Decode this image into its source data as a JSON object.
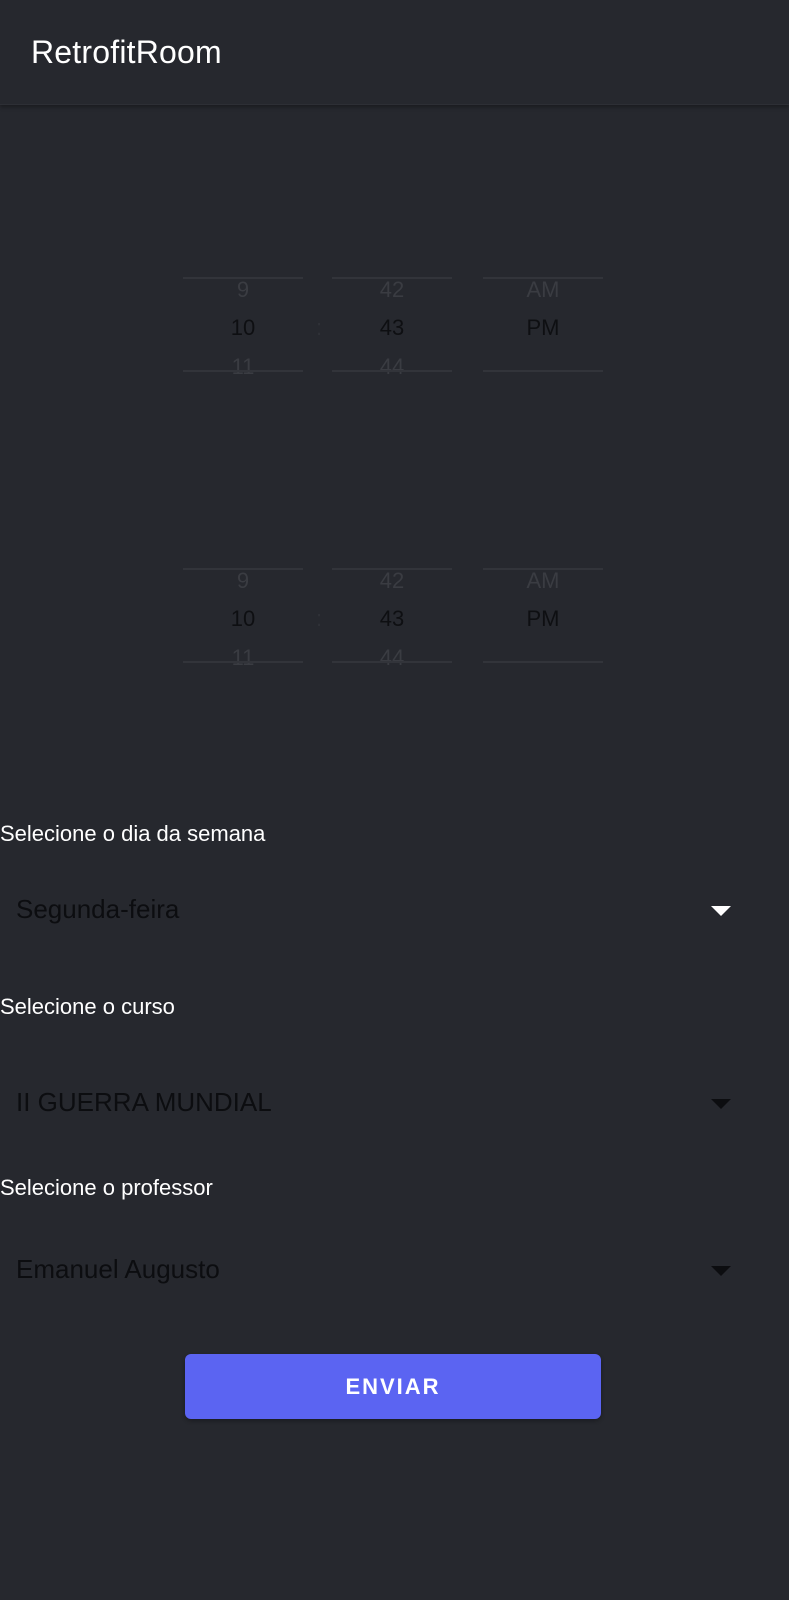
{
  "app": {
    "title": "RetrofitRoom"
  },
  "start_time": {
    "hour": {
      "prev": "9",
      "current": "10",
      "next": "11"
    },
    "separator": ":",
    "minute": {
      "prev": "42",
      "current": "43",
      "next": "44"
    },
    "ampm": {
      "prev": "AM",
      "current": "PM"
    }
  },
  "end_time": {
    "hour": {
      "prev": "9",
      "current": "10",
      "next": "11"
    },
    "separator": ":",
    "minute": {
      "prev": "42",
      "current": "43",
      "next": "44"
    },
    "ampm": {
      "prev": "AM",
      "current": "PM"
    }
  },
  "weekday": {
    "label": "Selecione o dia da semana",
    "selected": "Segunda-feira"
  },
  "course": {
    "label": "Selecione o curso",
    "selected": "II GUERRA MUNDIAL"
  },
  "teacher": {
    "label": "Selecione o professor",
    "selected": "Emanuel Augusto"
  },
  "submit": {
    "label": "ENVIAR"
  },
  "colors": {
    "background": "#26282e",
    "accent": "#5b64f2",
    "text_primary": "#ffffff"
  }
}
